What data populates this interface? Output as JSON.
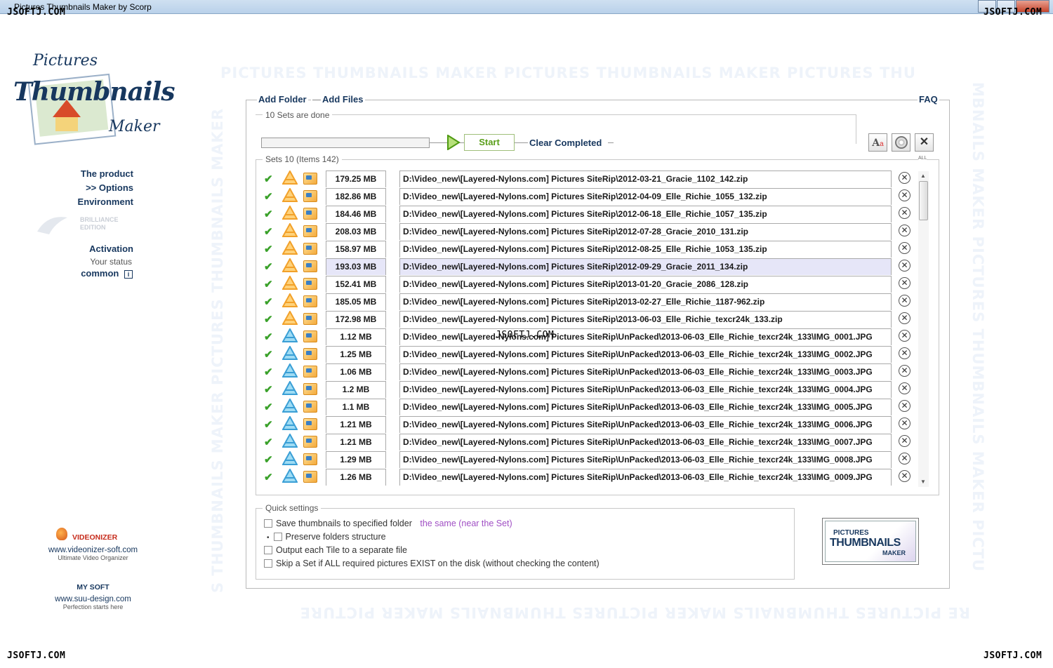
{
  "window": {
    "title": "Pictures Thumbnails Maker by Scorp"
  },
  "watermark": "JSOFTJ.COM",
  "background_text": {
    "top": "PICTURES THUMBNAILS MAKER PICTURES THUMBNAILS MAKER PICTURES THU",
    "bottom": "RE PICTURES THUMBNAILS MAKER PICTURES THUMBNAILS MAKER PICTURE",
    "left": "S THUMBNAILS MAKER PICTURES THUMBNAILS MAKER",
    "right": "MBNAILS MAKER PICTURES THUMBNAILS MAKER PICTU"
  },
  "logo": {
    "line1": "Pictures",
    "line2": "Thumbnails",
    "line3": "Maker"
  },
  "sidebar": {
    "product": "The product",
    "options": ">> Options",
    "environment": "Environment",
    "edition": "BRILLIANCE EDITION",
    "activation": "Activation",
    "status": "Your status",
    "common": "common",
    "info_icon": "i"
  },
  "promos": [
    {
      "name": "VIDEONIZER",
      "url": "www.videonizer-soft.com",
      "tagline": "Ultimate Video Organizer"
    },
    {
      "name": "MY SOFT",
      "url": "www.suu-design.com",
      "tagline": "Perfection starts here"
    }
  ],
  "toolbar": {
    "add_folder": "Add Folder",
    "separator": "—",
    "add_files": "Add Files",
    "faq": "FAQ"
  },
  "progress": {
    "status": "10 Sets are done",
    "start": "Start",
    "clear": "Clear Completed"
  },
  "tool_icons": [
    "font-icon",
    "disc-icon",
    "close-all-icon"
  ],
  "sets": {
    "header": "Sets 10 (Items 142)",
    "all_label": "ALL",
    "rows": [
      {
        "size": "179.25 MB",
        "path": "D:\\Video_new\\[Layered-Nylons.com] Pictures SiteRip\\2012-03-21_Gracie_1102_142.zip",
        "type": "archive",
        "selected": false
      },
      {
        "size": "182.86 MB",
        "path": "D:\\Video_new\\[Layered-Nylons.com] Pictures SiteRip\\2012-04-09_Elle_Richie_1055_132.zip",
        "type": "archive",
        "selected": false
      },
      {
        "size": "184.46 MB",
        "path": "D:\\Video_new\\[Layered-Nylons.com] Pictures SiteRip\\2012-06-18_Elle_Richie_1057_135.zip",
        "type": "archive",
        "selected": false
      },
      {
        "size": "208.03 MB",
        "path": "D:\\Video_new\\[Layered-Nylons.com] Pictures SiteRip\\2012-07-28_Gracie_2010_131.zip",
        "type": "archive",
        "selected": false
      },
      {
        "size": "158.97 MB",
        "path": "D:\\Video_new\\[Layered-Nylons.com] Pictures SiteRip\\2012-08-25_Elle_Richie_1053_135.zip",
        "type": "archive",
        "selected": false
      },
      {
        "size": "193.03 MB",
        "path": "D:\\Video_new\\[Layered-Nylons.com] Pictures SiteRip\\2012-09-29_Gracie_2011_134.zip",
        "type": "archive",
        "selected": true
      },
      {
        "size": "152.41 MB",
        "path": "D:\\Video_new\\[Layered-Nylons.com] Pictures SiteRip\\2013-01-20_Gracie_2086_128.zip",
        "type": "archive",
        "selected": false
      },
      {
        "size": "185.05 MB",
        "path": "D:\\Video_new\\[Layered-Nylons.com] Pictures SiteRip\\2013-02-27_Elle_Richie_1187-962.zip",
        "type": "archive",
        "selected": false
      },
      {
        "size": "172.98 MB",
        "path": "D:\\Video_new\\[Layered-Nylons.com] Pictures SiteRip\\2013-06-03_Elle_Richie_texcr24k_133.zip",
        "type": "archive",
        "selected": false
      },
      {
        "size": "1.12 MB",
        "path": "D:\\Video_new\\[Layered-Nylons.com] Pictures SiteRip\\UnPacked\\2013-06-03_Elle_Richie_texcr24k_133\\IMG_0001.JPG",
        "type": "image",
        "selected": false
      },
      {
        "size": "1.25 MB",
        "path": "D:\\Video_new\\[Layered-Nylons.com] Pictures SiteRip\\UnPacked\\2013-06-03_Elle_Richie_texcr24k_133\\IMG_0002.JPG",
        "type": "image",
        "selected": false
      },
      {
        "size": "1.06 MB",
        "path": "D:\\Video_new\\[Layered-Nylons.com] Pictures SiteRip\\UnPacked\\2013-06-03_Elle_Richie_texcr24k_133\\IMG_0003.JPG",
        "type": "image",
        "selected": false
      },
      {
        "size": "1.2 MB",
        "path": "D:\\Video_new\\[Layered-Nylons.com] Pictures SiteRip\\UnPacked\\2013-06-03_Elle_Richie_texcr24k_133\\IMG_0004.JPG",
        "type": "image",
        "selected": false
      },
      {
        "size": "1.1 MB",
        "path": "D:\\Video_new\\[Layered-Nylons.com] Pictures SiteRip\\UnPacked\\2013-06-03_Elle_Richie_texcr24k_133\\IMG_0005.JPG",
        "type": "image",
        "selected": false
      },
      {
        "size": "1.21 MB",
        "path": "D:\\Video_new\\[Layered-Nylons.com] Pictures SiteRip\\UnPacked\\2013-06-03_Elle_Richie_texcr24k_133\\IMG_0006.JPG",
        "type": "image",
        "selected": false
      },
      {
        "size": "1.21 MB",
        "path": "D:\\Video_new\\[Layered-Nylons.com] Pictures SiteRip\\UnPacked\\2013-06-03_Elle_Richie_texcr24k_133\\IMG_0007.JPG",
        "type": "image",
        "selected": false
      },
      {
        "size": "1.29 MB",
        "path": "D:\\Video_new\\[Layered-Nylons.com] Pictures SiteRip\\UnPacked\\2013-06-03_Elle_Richie_texcr24k_133\\IMG_0008.JPG",
        "type": "image",
        "selected": false
      },
      {
        "size": "1.26 MB",
        "path": "D:\\Video_new\\[Layered-Nylons.com] Pictures SiteRip\\UnPacked\\2013-06-03_Elle_Richie_texcr24k_133\\IMG_0009.JPG",
        "type": "image",
        "selected": false
      }
    ]
  },
  "quick_settings": {
    "title": "Quick settings",
    "save_label": "Save thumbnails to specified folder",
    "save_link": "the same (near the Set)",
    "preserve": "Preserve folders structure",
    "output_tile": "Output each Tile to a separate file",
    "skip_set": "Skip a Set if ALL required pictures EXIST on the disk (without checking the content)"
  },
  "product_logo": {
    "line1": "PICTURES",
    "line2": "THUMBNAILS",
    "line3": "MAKER"
  },
  "colors": {
    "accent": "#17375e",
    "start_green": "#5a9e1a",
    "link_purple": "#a04fc4",
    "selected_row": "#e6e6f8"
  }
}
